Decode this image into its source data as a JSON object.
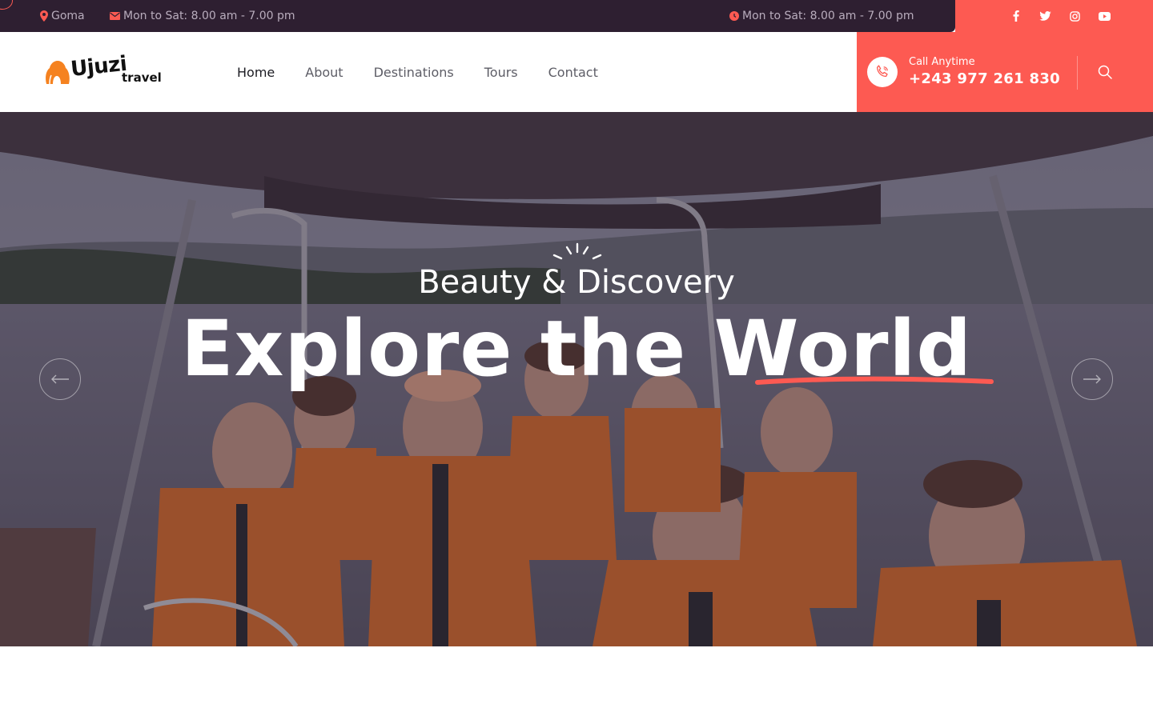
{
  "topbar": {
    "location": "Goma",
    "hours_email": "Mon to Sat: 8.00 am - 7.00 pm",
    "hours_clock": "Mon to Sat: 8.00 am - 7.00 pm",
    "socials": [
      "facebook-icon",
      "twitter-icon",
      "instagram-icon",
      "youtube-icon"
    ]
  },
  "logo": {
    "word1": "Ujuzi",
    "word2": "travel"
  },
  "nav": {
    "items": [
      {
        "label": "Home"
      },
      {
        "label": "About"
      },
      {
        "label": "Destinations"
      },
      {
        "label": "Tours"
      },
      {
        "label": "Contact"
      }
    ]
  },
  "call": {
    "label": "Call Anytime",
    "number": "+243 977 261 830"
  },
  "hero": {
    "subtitle": "Beauty & Discovery",
    "title": "Explore the World",
    "prev_icon": "arrow-left-icon",
    "next_icon": "arrow-right-icon"
  },
  "colors": {
    "accent": "#fd5a52",
    "topbar_bg": "#2e1f31",
    "logo_orange": "#f58220"
  }
}
